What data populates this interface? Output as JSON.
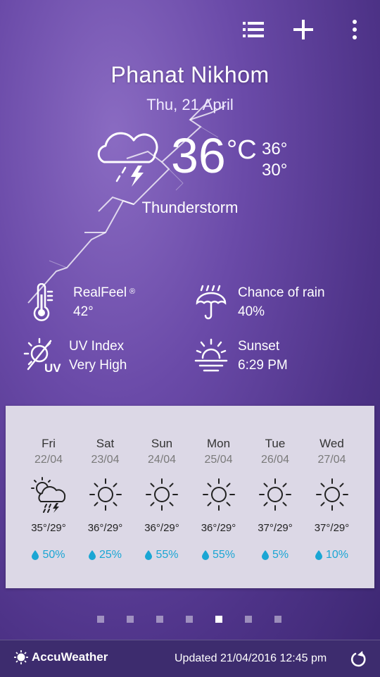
{
  "location": {
    "city": "Phanat Nikhom",
    "date": "Thu, 21 April"
  },
  "current": {
    "icon": "thunderstorm-icon",
    "temp": "36",
    "unit": "°C",
    "high": "36°",
    "low": "30°",
    "condition": "Thunderstorm"
  },
  "details": {
    "realfeel": {
      "label": "RealFeel",
      "mark": "®",
      "value": "42°"
    },
    "rain": {
      "label": "Chance of rain",
      "value": "40%"
    },
    "uv": {
      "label": "UV Index",
      "value": "Very High",
      "icon_text": "UV"
    },
    "sunset": {
      "label": "Sunset",
      "value": "6:29 PM"
    }
  },
  "forecast": [
    {
      "day": "Fri",
      "date": "22/04",
      "icon": "storm",
      "temps": "35°/29°",
      "rain": "50%"
    },
    {
      "day": "Sat",
      "date": "23/04",
      "icon": "sun",
      "temps": "36°/29°",
      "rain": "25%"
    },
    {
      "day": "Sun",
      "date": "24/04",
      "icon": "sun",
      "temps": "36°/29°",
      "rain": "55%"
    },
    {
      "day": "Mon",
      "date": "25/04",
      "icon": "sun",
      "temps": "36°/29°",
      "rain": "55%"
    },
    {
      "day": "Tue",
      "date": "26/04",
      "icon": "sun",
      "temps": "37°/29°",
      "rain": "5%"
    },
    {
      "day": "Wed",
      "date": "27/04",
      "icon": "sun",
      "temps": "37°/29°",
      "rain": "10%"
    }
  ],
  "pager": {
    "count": 7,
    "active_index": 4
  },
  "footer": {
    "brand": "AccuWeather",
    "updated": "Updated 21/04/2016 12:45 pm"
  },
  "colors": {
    "accent_rain": "#1aa6d4",
    "panel": "#dcd8e6",
    "footer": "#3d2c6e"
  }
}
